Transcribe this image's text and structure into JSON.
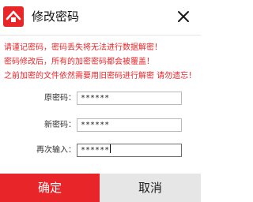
{
  "window": {
    "title": "修改密码",
    "logo_icon": "app-logo-icon",
    "close_icon": "close-icon"
  },
  "notices": [
    "请谨记密码，密码丢失将无法进行数据解密！",
    "密码修改后，所有的加密密码都会被覆盖！",
    "之前加密的文件依然需要用旧密码进行解密 请勿遗忘！"
  ],
  "form": {
    "old_password": {
      "label": "原密码：",
      "value": "******"
    },
    "new_password": {
      "label": "新密码：",
      "value": "******"
    },
    "confirm_password": {
      "label": "再次输入：",
      "value": "******"
    }
  },
  "buttons": {
    "confirm": "确定",
    "cancel": "取消"
  },
  "colors": {
    "accent": "#e8262a",
    "cancel_bg": "#e6e6e6"
  }
}
